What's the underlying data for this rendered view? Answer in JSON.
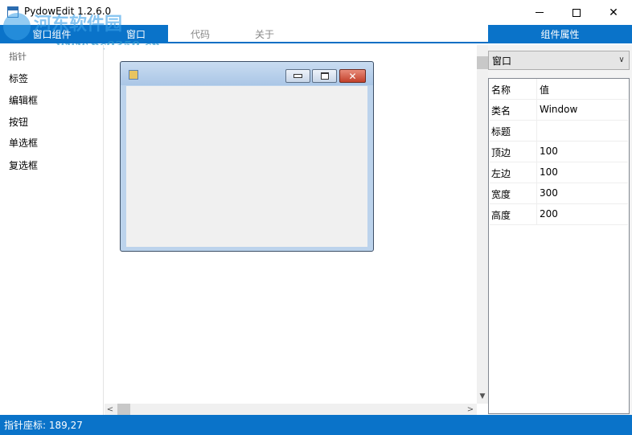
{
  "window": {
    "title": "PydowEdit 1.2.6.0",
    "minimize_glyph": "—",
    "maximize_glyph": "☐",
    "close_glyph": "✕"
  },
  "watermark": {
    "name": "河东软件园",
    "url": "www.pc0359.cn"
  },
  "tabs": {
    "components": "窗口组件",
    "window": "窗口",
    "code": "代码",
    "about": "关于",
    "properties": "组件属性"
  },
  "toolbox": {
    "items": [
      "指针",
      "标签",
      "编辑框",
      "按钮",
      "单选框",
      "复选框"
    ]
  },
  "properties": {
    "selected_component": "窗口",
    "header": {
      "key": "名称",
      "value": "值"
    },
    "rows": [
      {
        "key": "类名",
        "value": "Window"
      },
      {
        "key": "标题",
        "value": ""
      },
      {
        "key": "顶边",
        "value": "100"
      },
      {
        "key": "左边",
        "value": "100"
      },
      {
        "key": "宽度",
        "value": "300"
      },
      {
        "key": "高度",
        "value": "200"
      }
    ]
  },
  "form_preview": {
    "close_glyph": "✕"
  },
  "status": {
    "text": "指针座标: 189,27"
  },
  "colors": {
    "accent": "#0a73c9",
    "status_bar": "#0a73c9"
  }
}
